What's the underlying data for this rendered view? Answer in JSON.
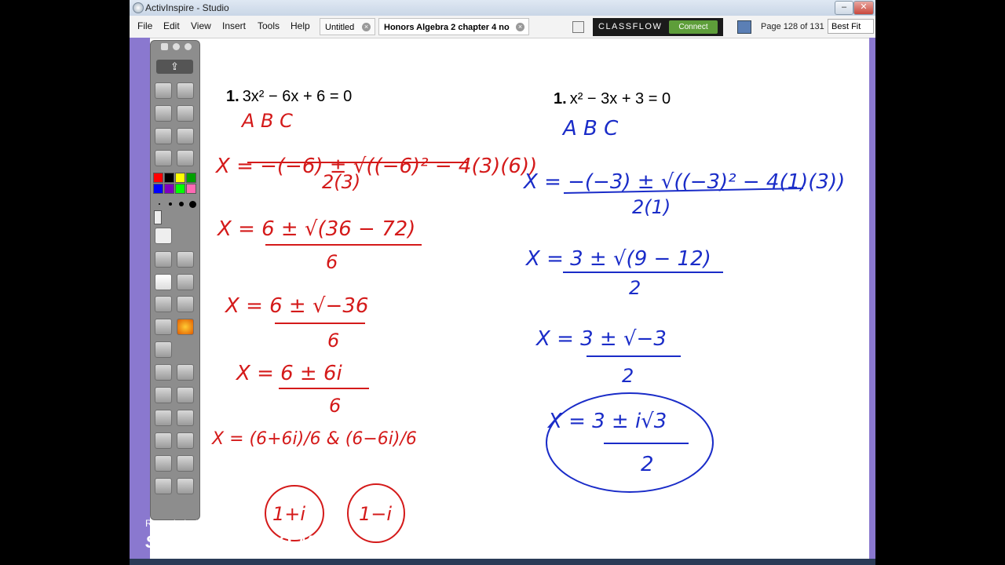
{
  "window": {
    "title": "ActivInspire - Studio"
  },
  "menu": [
    "File",
    "Edit",
    "View",
    "Insert",
    "Tools",
    "Help"
  ],
  "tabs": [
    {
      "label": "Untitled",
      "active": false
    },
    {
      "label": "Honors Algebra 2 chapter 4 no",
      "active": true
    }
  ],
  "classflow": {
    "brand": "CLASSFLOW",
    "connect": "Connect"
  },
  "page_info": "Page 128 of 131",
  "zoom": "Best Fit",
  "palette_colors": [
    "#ff0000",
    "#000000",
    "#ffff00",
    "#00a000",
    "#0000ff",
    "#8000c0",
    "#00ff00",
    "#ff69b4"
  ],
  "problems": {
    "left": {
      "number": "1.",
      "equation": "3x² − 6x + 6 = 0"
    },
    "right": {
      "number": "1.",
      "equation": "x² − 3x + 3 = 0"
    }
  },
  "handwriting": {
    "left_color": "#d41a1a",
    "right_color": "#1a2cc8",
    "left_lines": [
      "A      B      C",
      "X = −(−6) ± √((−6)² − 4(3)(6))",
      "2(3)",
      "X = 6 ± √(36 − 72)",
      "6",
      "X = 6 ± √−36",
      "6",
      "X = 6 ± 6i",
      "6",
      "X = (6+6i)/6  &  (6−6i)/6",
      "1+i",
      "1−i"
    ],
    "right_lines": [
      "A     B     C",
      "X = −(−3) ± √((−3)² − 4(1)(3))",
      "2(1)",
      "X = 3 ± √(9 − 12)",
      "2",
      "X = 3 ± √−3",
      "2",
      "X = 3 ± i√3",
      "2"
    ]
  },
  "watermark": {
    "line1": "Recorded with",
    "line2": "SCREENCAST-O-MATIC"
  }
}
